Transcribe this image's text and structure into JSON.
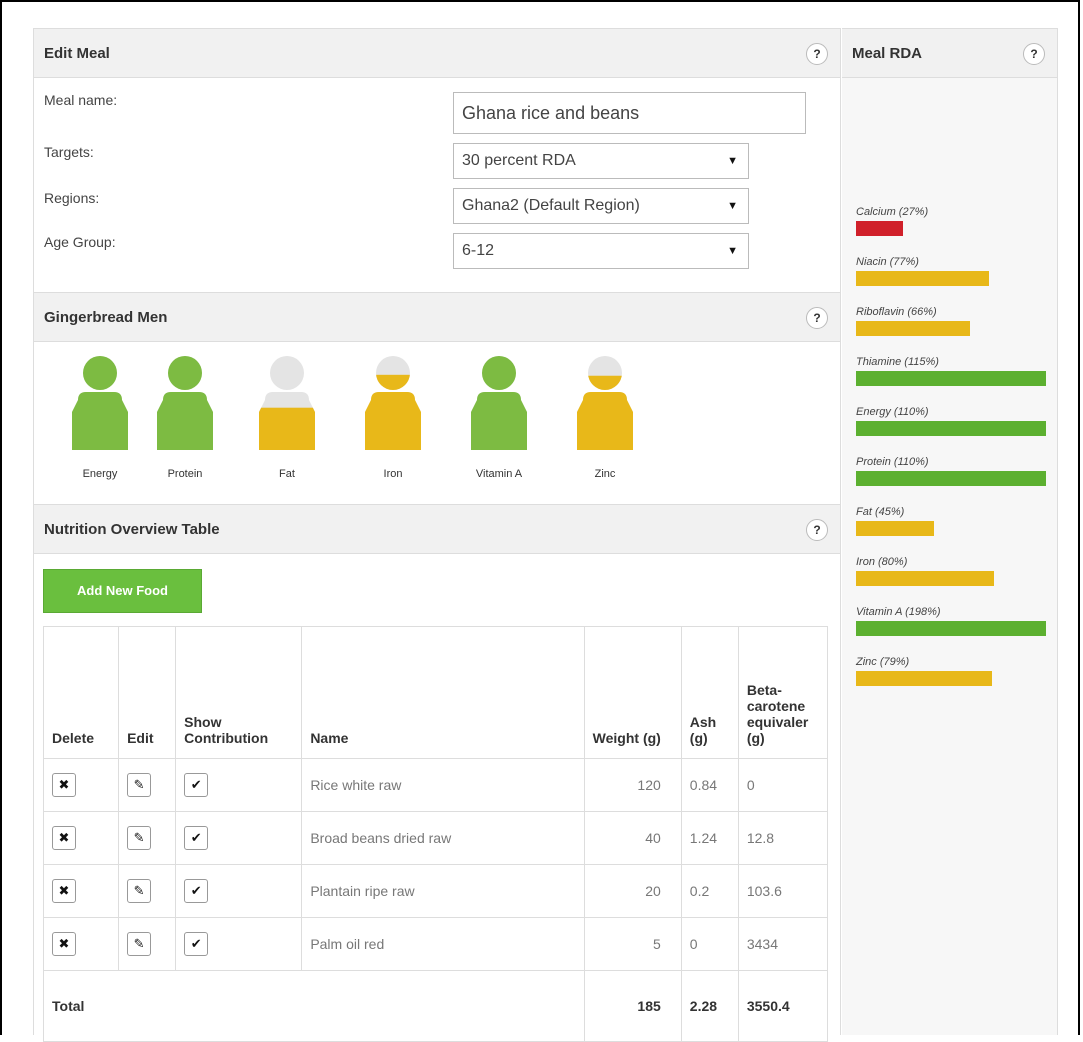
{
  "edit_meal": {
    "title": "Edit Meal",
    "help": "?",
    "meal_name_label": "Meal name:",
    "meal_name_value": "Ghana rice and beans",
    "targets_label": "Targets:",
    "targets_value": "30 percent RDA",
    "regions_label": "Regions:",
    "regions_value": "Ghana2 (Default Region)",
    "age_group_label": "Age Group:",
    "age_group_value": "6-12",
    "select_arrow": "▼"
  },
  "gingerbread": {
    "title": "Gingerbread Men",
    "help": "?",
    "men": [
      {
        "label": "Energy",
        "fill": 1.0,
        "color": "#7dbb42"
      },
      {
        "label": "Protein",
        "fill": 1.0,
        "color": "#7dbb42"
      },
      {
        "label": "Fat",
        "fill": 0.45,
        "color": "#e8b819"
      },
      {
        "label": "Iron",
        "fill": 0.8,
        "color": "#e8b819"
      },
      {
        "label": "Vitamin A",
        "fill": 1.0,
        "color": "#7dbb42"
      },
      {
        "label": "Zinc",
        "fill": 0.79,
        "color": "#e8b819"
      }
    ]
  },
  "nutrition": {
    "title": "Nutrition Overview Table",
    "help": "?",
    "add_button": "Add New Food",
    "headers": {
      "delete": "Delete",
      "edit": "Edit",
      "show": "Show Contribution",
      "name": "Name",
      "weight": "Weight (g)",
      "ash": "Ash (g)",
      "beta": "Beta-carotene equivaler (g)"
    },
    "icons": {
      "delete": "✖",
      "edit": "✎",
      "show": "✔"
    },
    "rows": [
      {
        "name": "Rice white raw",
        "weight": "120",
        "ash": "0.84",
        "beta": "0"
      },
      {
        "name": "Broad beans dried raw",
        "weight": "40",
        "ash": "1.24",
        "beta": "12.8"
      },
      {
        "name": "Plantain ripe raw",
        "weight": "20",
        "ash": "0.2",
        "beta": "103.6"
      },
      {
        "name": "Palm oil red",
        "weight": "5",
        "ash": "0",
        "beta": "3434"
      }
    ],
    "total": {
      "label": "Total",
      "weight": "185",
      "ash": "2.28",
      "beta": "3550.4"
    }
  },
  "rda": {
    "title": "Meal RDA",
    "help": "?",
    "colors": {
      "red": "#d0202a",
      "yellow": "#e8b819",
      "green": "#5cb030"
    },
    "items": [
      {
        "label": "Calcium (27%)",
        "percent": 27,
        "color": "red"
      },
      {
        "label": "Niacin (77%)",
        "percent": 77,
        "color": "yellow"
      },
      {
        "label": "Riboflavin (66%)",
        "percent": 66,
        "color": "yellow"
      },
      {
        "label": "Thiamine (115%)",
        "percent": 115,
        "color": "green"
      },
      {
        "label": "Energy (110%)",
        "percent": 110,
        "color": "green"
      },
      {
        "label": "Protein (110%)",
        "percent": 110,
        "color": "green"
      },
      {
        "label": "Fat (45%)",
        "percent": 45,
        "color": "yellow"
      },
      {
        "label": "Iron (80%)",
        "percent": 80,
        "color": "yellow"
      },
      {
        "label": "Vitamin A (198%)",
        "percent": 198,
        "color": "green"
      },
      {
        "label": "Zinc (79%)",
        "percent": 79,
        "color": "yellow"
      }
    ]
  }
}
